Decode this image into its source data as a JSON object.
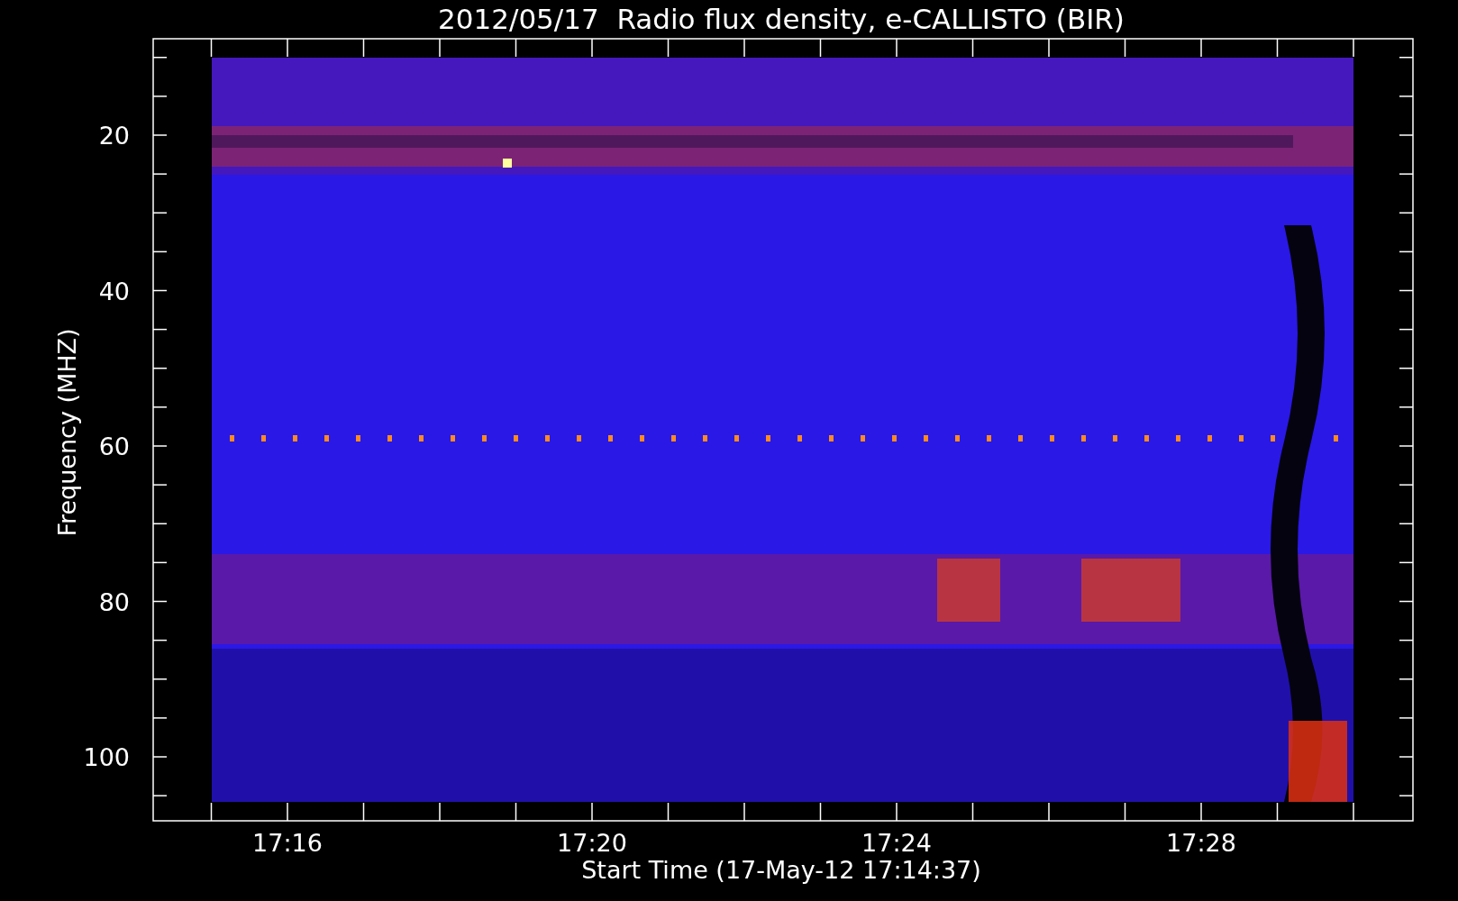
{
  "title": "2012/05/17  Radio flux density, e-CALLISTO (BIR)",
  "plot": {
    "ylabel": "Frequency (MHZ)",
    "xlabel": "Start Time (17-May-12 17:14:37)",
    "xticks": [
      "17:16",
      "17:20",
      "17:24",
      "17:28"
    ],
    "yticks": [
      "20",
      "40",
      "60",
      "80",
      "100"
    ]
  }
}
